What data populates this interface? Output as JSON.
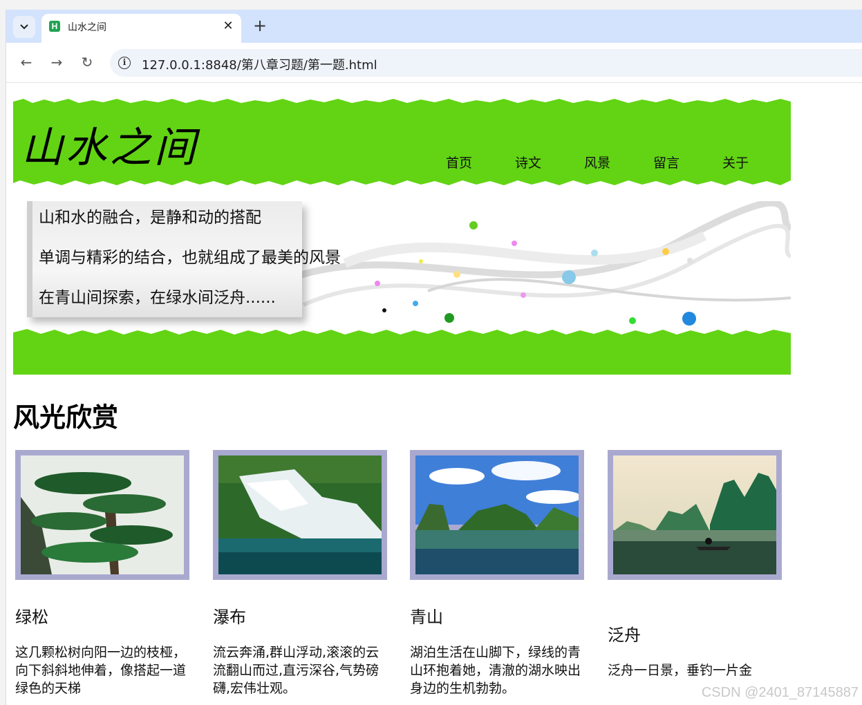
{
  "browser": {
    "tab_title": "山水之间",
    "url": "127.0.0.1:8848/第八章习题/第一题.html",
    "favicon_letter": "H"
  },
  "site": {
    "logo": "山水之间",
    "nav": [
      "首页",
      "诗文",
      "风景",
      "留言",
      "关于"
    ],
    "banner_lines": [
      "山和水的融合，是静和动的搭配",
      "单调与精彩的结合，也就组成了最美的风景",
      "在青山间探索，在绿水间泛舟......"
    ],
    "section_title": "风光欣赏",
    "cards": [
      {
        "title": "绿松",
        "text": "这几颗松树向阳一边的枝桠，向下斜斜地伸着，像搭起一道绿色的天梯"
      },
      {
        "title": "瀑布",
        "text": "流云奔涌,群山浮动,滚滚的云流翻山而过,直污深谷,气势磅礴,宏伟壮观。"
      },
      {
        "title": "青山",
        "text": "湖泊生活在山脚下，绿线的青山环抱着她，清澈的湖水映出身边的生机勃勃。"
      },
      {
        "title": "泛舟",
        "text": "泛舟一日景，垂钓一片金"
      }
    ]
  },
  "watermark": "CSDN @2401_87145887",
  "colors": {
    "grass": "#62d414",
    "photo_frame": "#a9a9d0",
    "tabstrip": "#d3e3fd"
  }
}
